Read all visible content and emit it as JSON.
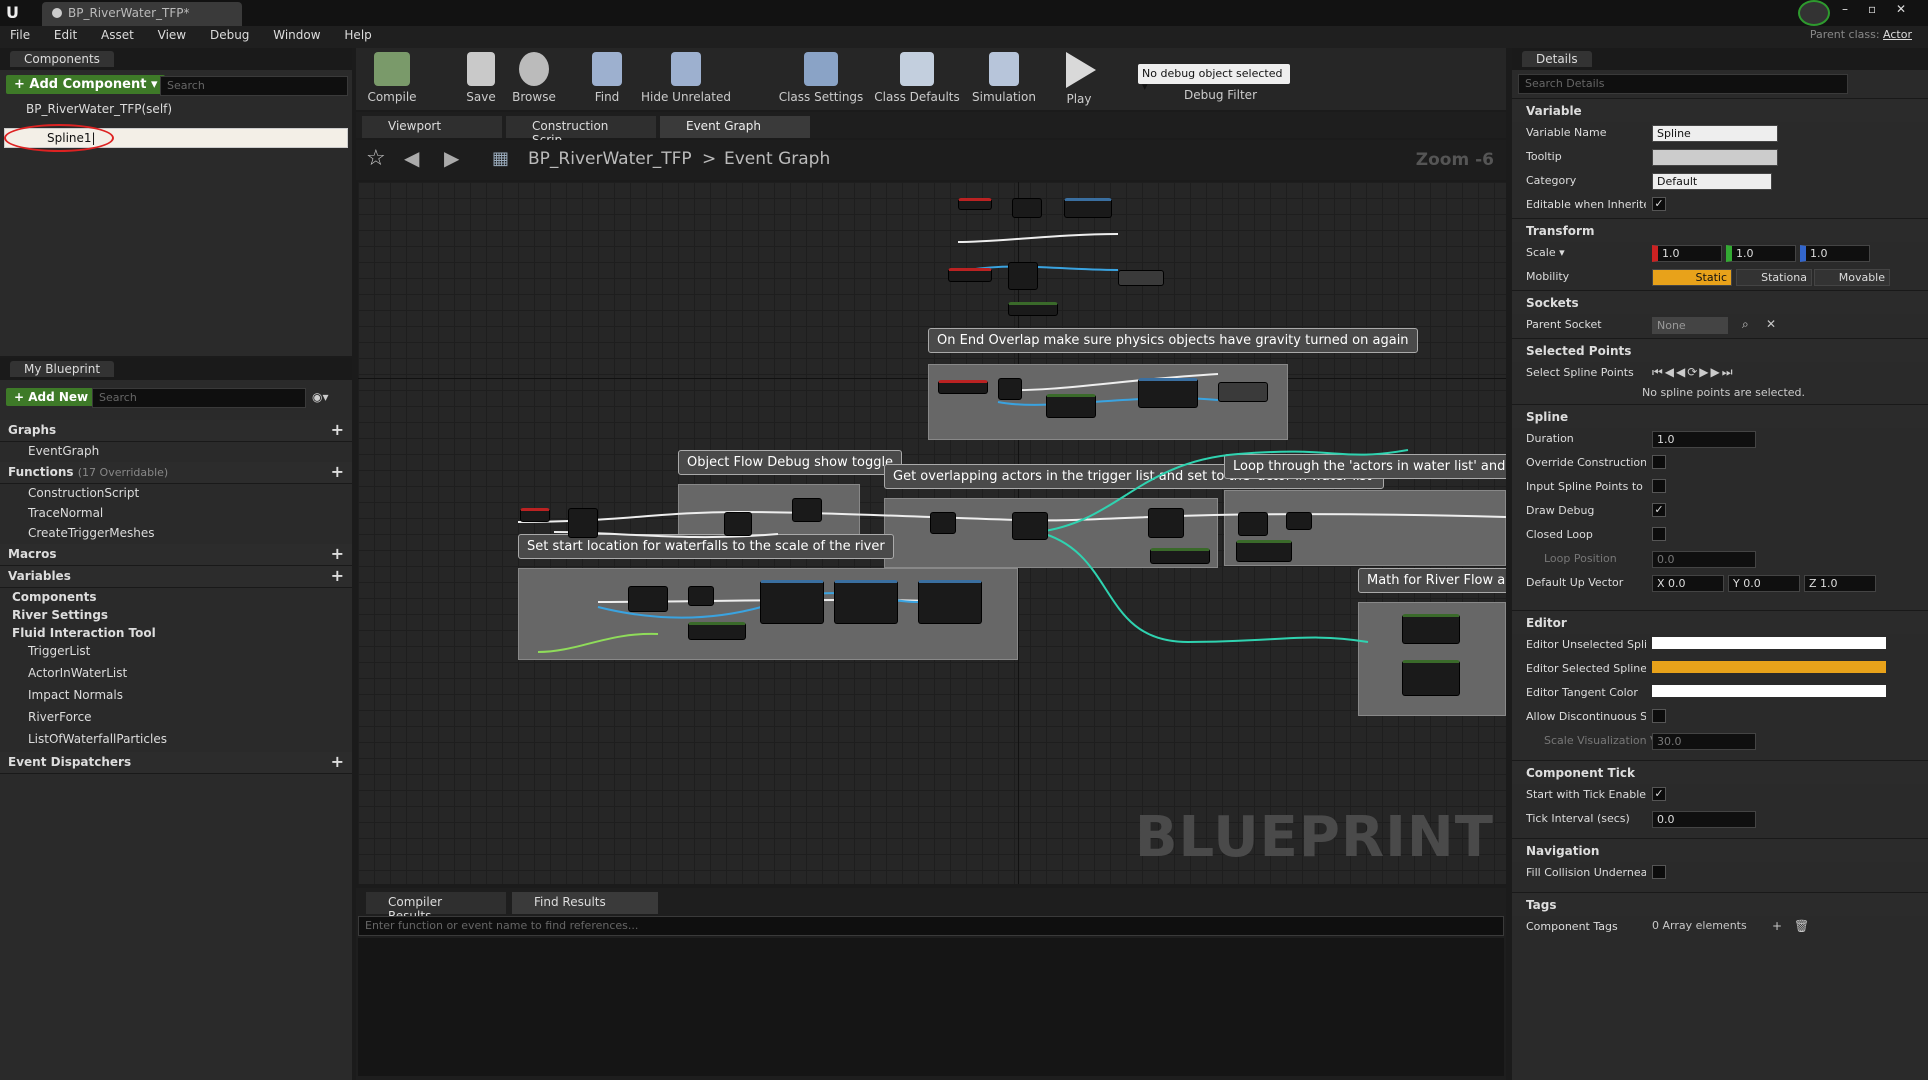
{
  "window": {
    "doc_tab": "BP_RiverWater_TFP*",
    "parent_class_label": "Parent class:",
    "parent_class": "Actor"
  },
  "menu": [
    "File",
    "Edit",
    "Asset",
    "View",
    "Debug",
    "Window",
    "Help"
  ],
  "components": {
    "tab": "Components",
    "add": "+ Add Component ▾",
    "search": "Search",
    "root": "BP_RiverWater_TFP(self)",
    "selected": "Spline1|"
  },
  "toolbar": {
    "compile": "Compile",
    "save": "Save",
    "browse": "Browse",
    "find": "Find",
    "hide": "Hide Unrelated",
    "class_settings": "Class Settings",
    "class_defaults": "Class Defaults",
    "simulation": "Simulation",
    "play": "Play",
    "debug_select": "No debug object selected ▾",
    "debug_filter": "Debug Filter"
  },
  "graphtabs": [
    "Viewport",
    "Construction Scrip",
    "Event Graph"
  ],
  "breadcrumb": {
    "bp": "BP_RiverWater_TFP",
    "sep": ">",
    "graph": "Event Graph",
    "zoom": "Zoom -6"
  },
  "comments": {
    "c1": "On End Overlap make sure physics objects have gravity turned on again",
    "c2": "Object Flow Debug show toggle",
    "c3": "Get overlapping actors in the trigger list and set to the 'actor in water list'",
    "c4": "Loop through the 'actors in water list' and get th",
    "c5": "Set start location for waterfalls to the scale of the river",
    "c6": "Math for River Flow and Bu"
  },
  "watermark": "BLUEPRINT",
  "mybp": {
    "tab": "My Blueprint",
    "add": "+ Add New ▾",
    "search": "Search",
    "graphs": "Graphs",
    "eventgraph": "EventGraph",
    "functions": "Functions",
    "functions_note": "(17 Overridable)",
    "fn": [
      "ConstructionScript",
      "TraceNormal",
      "CreateTriggerMeshes"
    ],
    "macros": "Macros",
    "variables": "Variables",
    "vgroups": [
      "Components",
      "River Settings",
      "Fluid Interaction Tool"
    ],
    "vars": [
      "TriggerList",
      "ActorInWaterList",
      "Impact Normals",
      "RiverForce",
      "ListOfWaterfallParticles"
    ],
    "dispatchers": "Event Dispatchers"
  },
  "bottom": {
    "tabs": [
      "Compiler Results",
      "Find Results"
    ],
    "search": "Enter function or event name to find references..."
  },
  "details": {
    "tab": "Details",
    "search": "Search Details",
    "variable": "Variable",
    "var_name_l": "Variable Name",
    "var_name": "Spline",
    "tooltip_l": "Tooltip",
    "category_l": "Category",
    "category": "Default",
    "editable_l": "Editable when Inherited",
    "transform": "Transform",
    "scale_l": "Scale ▾",
    "sx": "1.0",
    "sy": "1.0",
    "sz": "1.0",
    "mobility_l": "Mobility",
    "static": "Static",
    "stationary": "Stationa",
    "movable": "Movable",
    "sockets": "Sockets",
    "parent_socket_l": "Parent Socket",
    "parent_socket": "None",
    "selpoints": "Selected Points",
    "sel_spline_l": "Select Spline Points",
    "no_points": "No spline points are selected.",
    "spline": "Spline",
    "duration_l": "Duration",
    "duration": "1.0",
    "override_l": "Override Construction S",
    "input_l": "Input Spline Points to Co",
    "drawdebug_l": "Draw Debug",
    "closed_l": "Closed Loop",
    "looppos_l": "Loop Position",
    "looppos": "0.0",
    "upvec_l": "Default Up Vector",
    "ux": "X 0.0",
    "uy": "Y 0.0",
    "uz": "Z 1.0",
    "editor": "Editor",
    "unsel_l": "Editor Unselected Spline",
    "sel_l": "Editor Selected Spline S",
    "tangent_l": "Editor Tangent Color",
    "allow_l": "Allow Discontinuous Spl",
    "scalevis_l": "Scale Visualization V",
    "scalevis": "30.0",
    "comptick": "Component Tick",
    "start_tick_l": "Start with Tick Enabled",
    "tick_int_l": "Tick Interval (secs)",
    "tick_int": "0.0",
    "navigation": "Navigation",
    "fill_l": "Fill Collision Underneath",
    "tags": "Tags",
    "comp_tags_l": "Component Tags",
    "comp_tags": "0 Array elements"
  },
  "colors": {
    "accent_green": "#3e7a28",
    "selected_orange": "#e8a21a",
    "wire_teal": "#2fd3b0",
    "wire_blue": "#3aa3e0"
  }
}
